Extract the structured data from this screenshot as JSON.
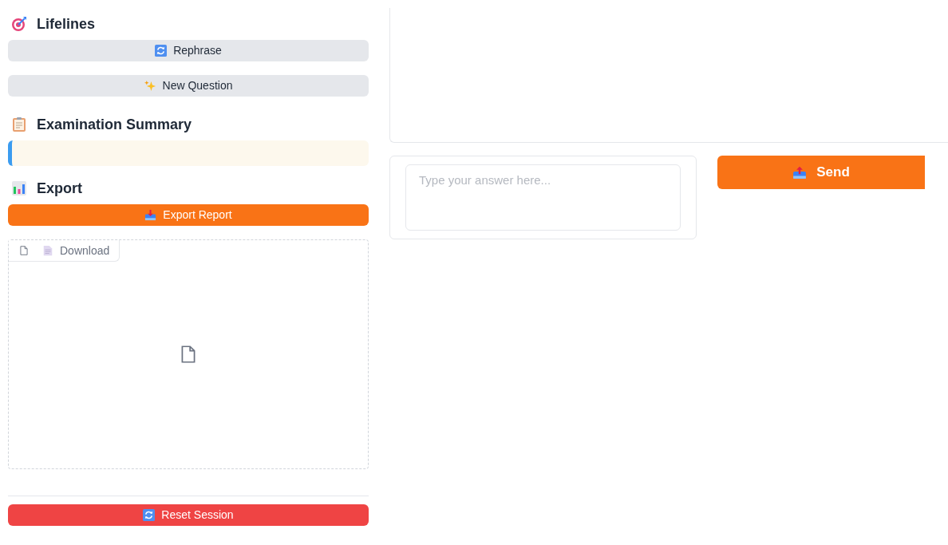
{
  "sidebar": [
    {
      "kind": "heading",
      "text": "Lifelines"
    },
    {
      "kind": "button",
      "label": "Rephrase"
    },
    {
      "kind": "button",
      "label": "New Question"
    },
    {
      "kind": "heading",
      "text": "Examination Summary"
    },
    {
      "kind": "summary"
    },
    {
      "kind": "heading",
      "text": "Export"
    },
    {
      "kind": "button",
      "label": "Export Report"
    },
    {
      "kind": "file",
      "label": "Download"
    },
    {
      "kind": "divider"
    },
    {
      "kind": "button",
      "label": "Reset Session"
    }
  ],
  "answer": {
    "placeholder": "Type your answer here..."
  },
  "send_button": {
    "label": "Send"
  }
}
